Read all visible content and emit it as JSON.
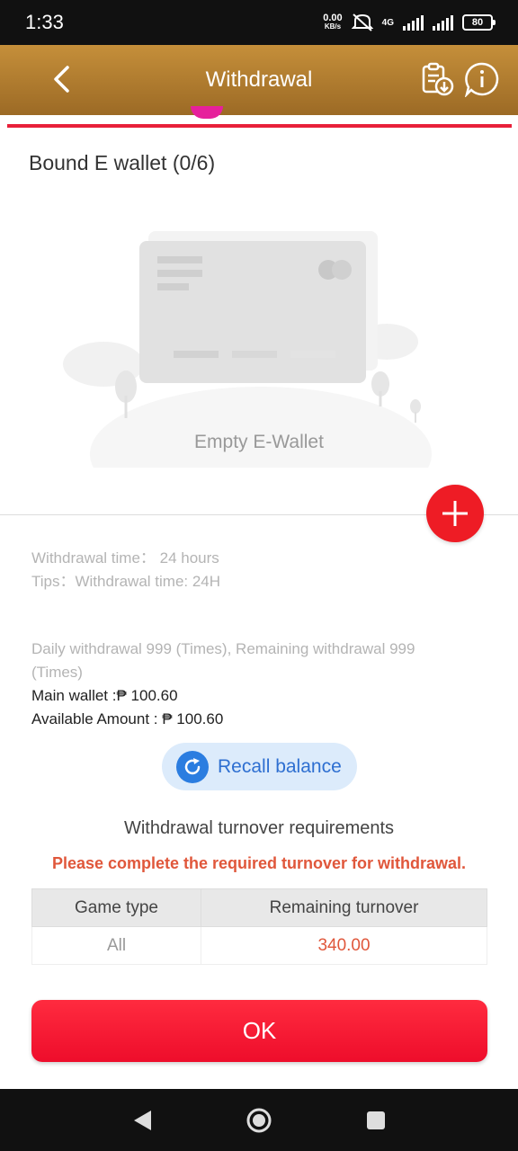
{
  "status_bar": {
    "time": "1:33",
    "net_speed_value": "0.00",
    "net_speed_unit": "KB/s",
    "network_type": "4G",
    "battery": "80"
  },
  "header": {
    "title": "Withdrawal",
    "back_icon": "chevron-left-icon",
    "records_icon": "clipboard-download-icon",
    "info_icon": "info-icon"
  },
  "ewallet": {
    "title": "Bound E wallet (0/6)",
    "empty_label": "Empty E-Wallet"
  },
  "info": {
    "withdrawal_time": "Withdrawal time：  24 hours",
    "tips": "Tips：Withdrawal time: 24H",
    "daily_line1": "Daily withdrawal 999 (Times), Remaining withdrawal 999",
    "daily_line2": "(Times)",
    "main_wallet": "Main wallet :₱ 100.60",
    "available_amount": "Available Amount : ₱ 100.60"
  },
  "recall": {
    "label": "Recall balance"
  },
  "turnover": {
    "title": "Withdrawal turnover requirements",
    "warning": "Please complete the required turnover for withdrawal.",
    "headers": [
      "Game type",
      "Remaining turnover"
    ],
    "rows": [
      {
        "game_type": "All",
        "remaining": "340.00"
      }
    ]
  },
  "ok_label": "OK",
  "colors": {
    "header_gold": "#b07c30",
    "accent_red": "#ee1c25",
    "recall_blue": "#2b7de0",
    "warning_orange": "#e0573b"
  }
}
